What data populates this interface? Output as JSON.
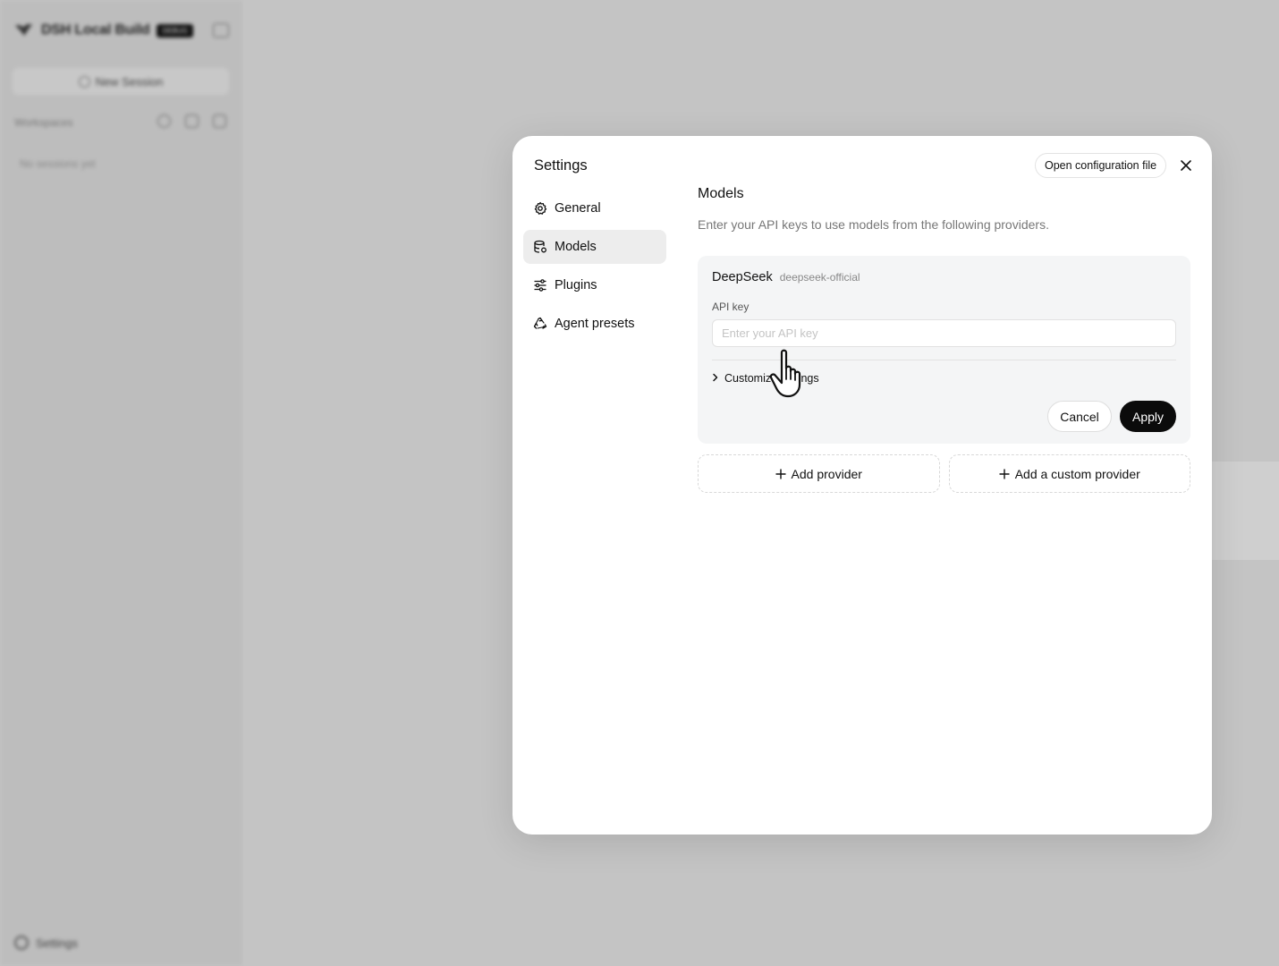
{
  "sidebar": {
    "app_title": "DSH Local Build",
    "badge": "DEBUG",
    "new_session_label": "New Session",
    "workspaces_label": "Workspaces",
    "empty_label": "No sessions yet",
    "settings_label": "Settings"
  },
  "modal": {
    "title": "Settings",
    "open_config_label": "Open configuration file",
    "nav": {
      "general": "General",
      "models": "Models",
      "plugins": "Plugins",
      "agent_presets": "Agent presets"
    },
    "active_nav": "Models",
    "content": {
      "title": "Models",
      "description": "Enter your API keys to use models from the following providers.",
      "provider": {
        "name": "DeepSeek",
        "id": "deepseek-official",
        "api_key_label": "API key",
        "api_key_placeholder": "Enter your API key",
        "api_key_value": "",
        "customize_label": "Customize settings",
        "cancel_label": "Cancel",
        "apply_label": "Apply"
      },
      "add_provider_label": "Add provider",
      "add_custom_provider_label": "Add a custom provider"
    }
  },
  "icons": {
    "close": "close-icon",
    "general": "gear-icon",
    "models": "database-icon",
    "plugins": "sliders-icon",
    "agent_presets": "recycle-icon",
    "customize": "chevron-right-icon",
    "add": "plus-icon",
    "cursor": "hand-pointer-icon"
  },
  "colors": {
    "apply_bg": "#0b0b0b",
    "active_nav_bg": "#ededed",
    "card_bg": "#f4f5f6",
    "overlay": "#c6c6c6"
  }
}
